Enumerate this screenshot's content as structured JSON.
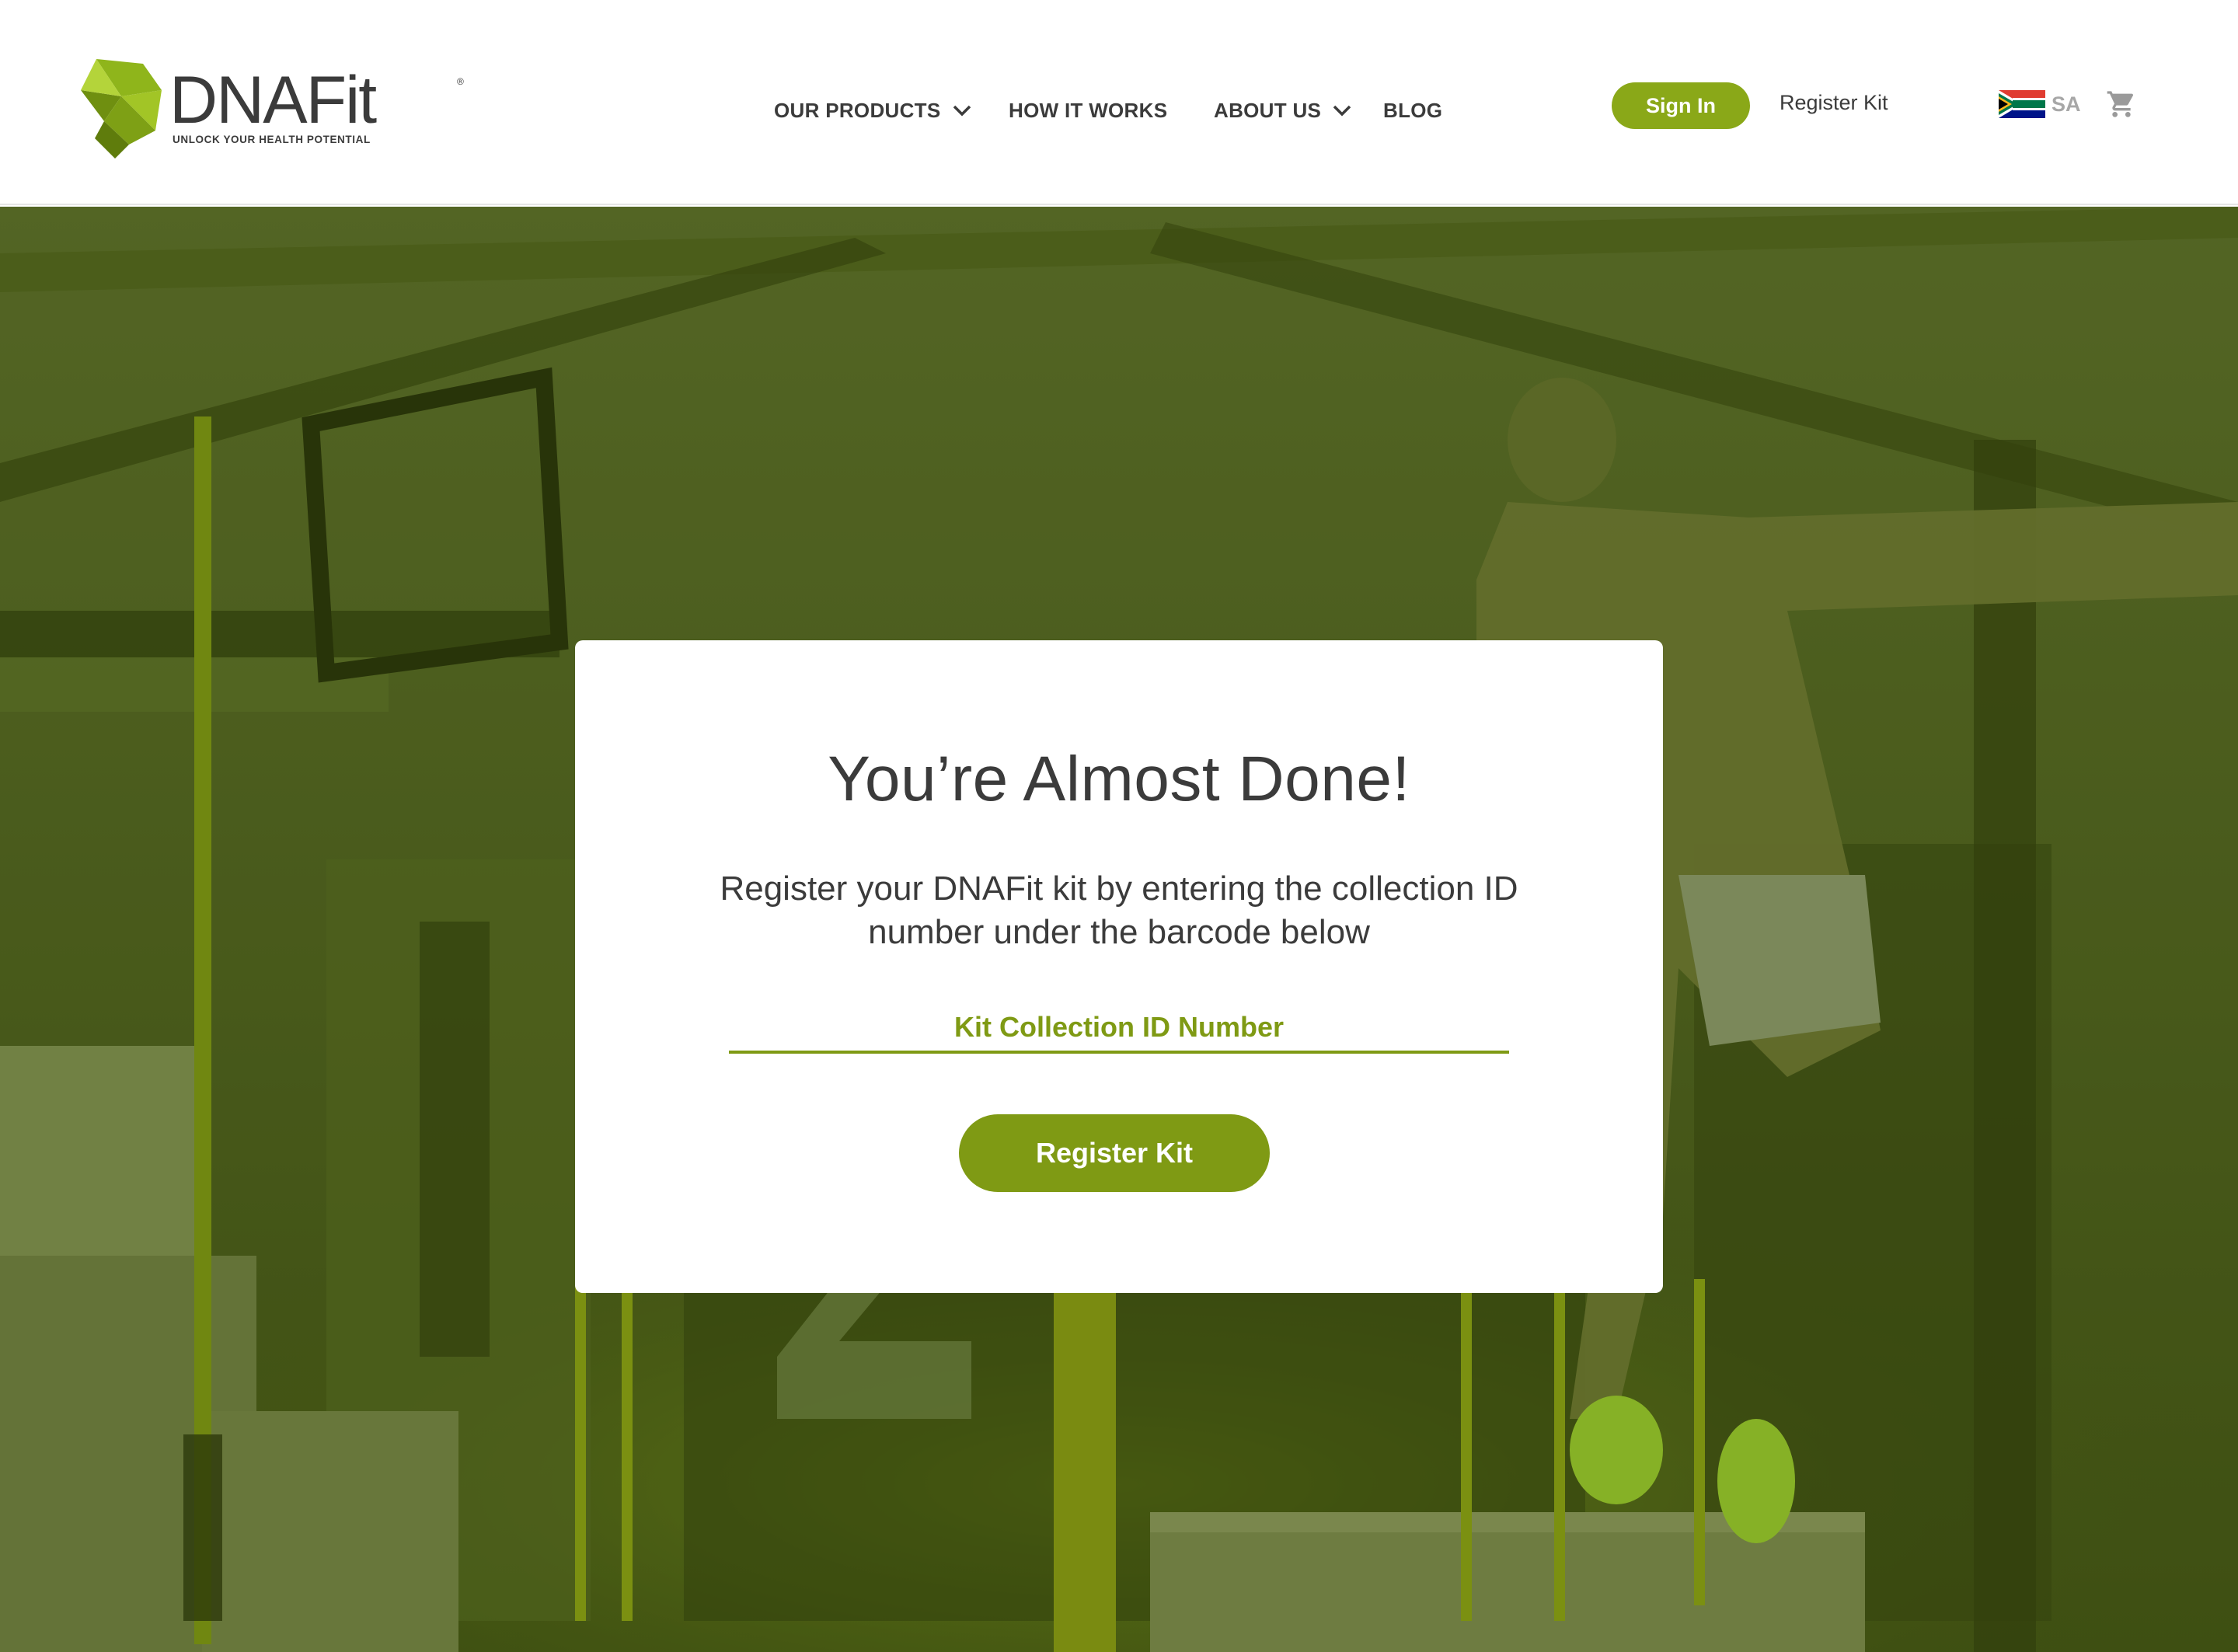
{
  "brand": {
    "name_prefix": "DNA",
    "name_suffix": "Fit",
    "registered": "®",
    "tagline": "UNLOCK YOUR HEALTH POTENTIAL",
    "color": "#8aa818"
  },
  "nav": {
    "items": [
      {
        "label": "OUR PRODUCTS",
        "has_dropdown": true
      },
      {
        "label": "HOW IT WORKS",
        "has_dropdown": false
      },
      {
        "label": "ABOUT US",
        "has_dropdown": true
      },
      {
        "label": "BLOG",
        "has_dropdown": false
      }
    ]
  },
  "header": {
    "sign_in_label": "Sign In",
    "register_kit_label": "Register Kit",
    "region_code": "SA",
    "flag_icon": "south-africa-flag-icon",
    "cart_icon": "shopping-cart-icon"
  },
  "card": {
    "title": "You’re Almost Done!",
    "subtitle": "Register your DNAFit kit by entering the collection ID number under the barcode below",
    "input_placeholder": "Kit Collection ID Number",
    "input_value": "",
    "button_label": "Register Kit"
  },
  "colors": {
    "accent": "#7f9a14",
    "text": "#3b3b3b",
    "overlay": "#4a5e14"
  }
}
